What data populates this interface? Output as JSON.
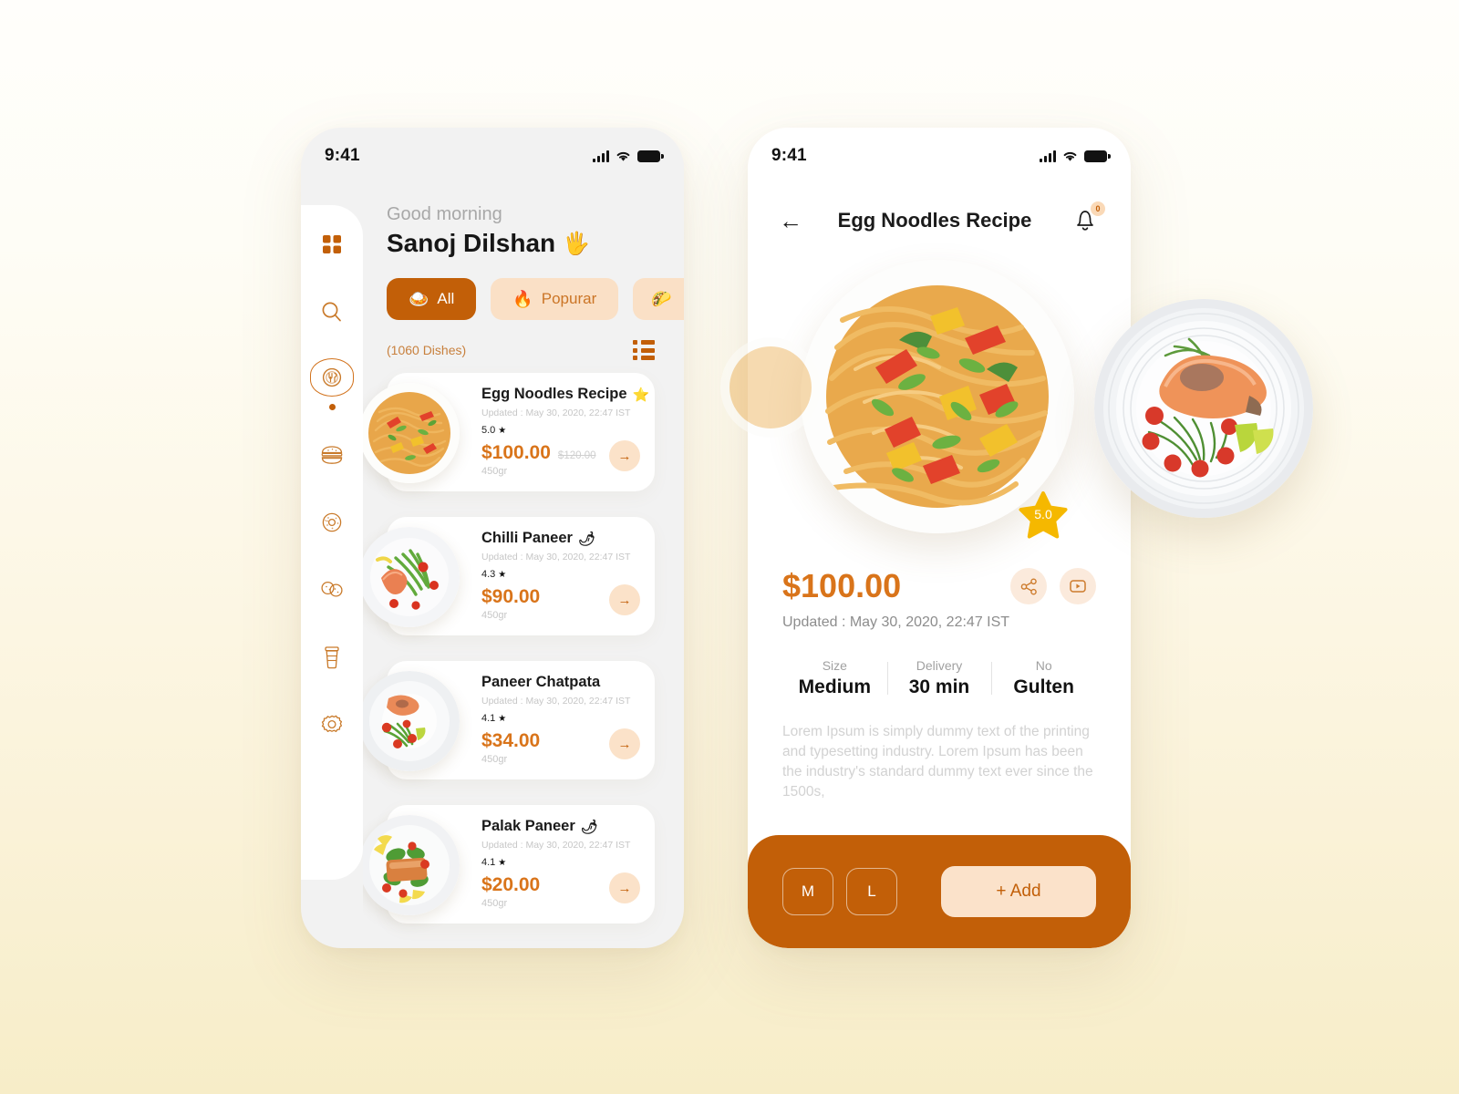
{
  "theme": {
    "accent": "#c25f08",
    "accent_light": "#fae0c6",
    "price_orange": "#d9741a",
    "muted": "#c6c6c6",
    "bg_gradient_from": "#fffefb",
    "bg_gradient_to": "#f7edc8"
  },
  "status_bar": {
    "time": "9:41",
    "signal_icon": "cellular-signal-icon",
    "wifi_icon": "wifi-icon",
    "battery_icon": "battery-icon"
  },
  "home": {
    "greeting": "Good morning",
    "user_name": "Sanoj Dilshan",
    "wave_emoji": "🖐",
    "chips": [
      {
        "label": "All",
        "emoji": "🍛",
        "active": true
      },
      {
        "label": "Popurar",
        "emoji": "🔥",
        "active": false
      },
      {
        "label": "",
        "emoji": "🌮",
        "active": false
      }
    ],
    "dish_count": "(1060 Dishes)",
    "list_toggle_icon": "list-view-icon",
    "sidebar": [
      {
        "name": "grid",
        "icon": "grid-icon",
        "active": false
      },
      {
        "name": "search",
        "icon": "search-icon",
        "active": false
      },
      {
        "name": "dishes",
        "icon": "plate-cutlery-icon",
        "active": true
      },
      {
        "name": "burger",
        "icon": "burger-icon",
        "active": false
      },
      {
        "name": "donut",
        "icon": "donut-icon",
        "active": false
      },
      {
        "name": "cookies",
        "icon": "cookies-icon",
        "active": false
      },
      {
        "name": "drink",
        "icon": "coffee-cup-icon",
        "active": false
      },
      {
        "name": "settings",
        "icon": "gear-icon",
        "active": false
      }
    ],
    "dishes": [
      {
        "title": "Egg Noodles Recipe",
        "tag_emoji": "⭐",
        "updated": "Updated : May 30, 2020, 22:47 IST",
        "rating": "5.0",
        "price": "$100.00",
        "old_price": "$120.00",
        "weight": "450gr",
        "go_icon": "arrow-right-icon"
      },
      {
        "title": "Chilli Paneer",
        "tag_emoji": "🌶",
        "updated": "Updated : May 30, 2020, 22:47 IST",
        "rating": "4.3",
        "price": "$90.00",
        "old_price": "",
        "weight": "450gr",
        "go_icon": "arrow-right-icon"
      },
      {
        "title": "Paneer Chatpata",
        "tag_emoji": "",
        "updated": "Updated : May 30, 2020, 22:47 IST",
        "rating": "4.1",
        "price": "$34.00",
        "old_price": "",
        "weight": "450gr",
        "go_icon": "arrow-right-icon"
      },
      {
        "title": "Palak Paneer",
        "tag_emoji": "🌶",
        "updated": "Updated : May 30, 2020, 22:47 IST",
        "rating": "4.1",
        "price": "$20.00",
        "old_price": "",
        "weight": "450gr",
        "go_icon": "arrow-right-icon"
      }
    ]
  },
  "detail": {
    "back_icon": "back-arrow-icon",
    "title": "Egg Noodles Recipe",
    "bell_icon": "bell-icon",
    "bell_badge": "0",
    "hero_rating": "5.0",
    "price": "$100.00",
    "share_icon": "share-icon",
    "video_icon": "video-play-icon",
    "updated": "Updated : May 30, 2020, 22:47 IST",
    "specs": [
      {
        "label": "Size",
        "value": "Medium"
      },
      {
        "label": "Delivery",
        "value": "30 min"
      },
      {
        "label": "No",
        "value": "Gulten"
      }
    ],
    "description": "Lorem Ipsum is simply dummy text of the printing and typesetting industry. Lorem Ipsum has been the industry's standard dummy text ever since the 1500s,",
    "sizes": [
      {
        "label": "M"
      },
      {
        "label": "L"
      }
    ],
    "add_button": "+ Add"
  }
}
